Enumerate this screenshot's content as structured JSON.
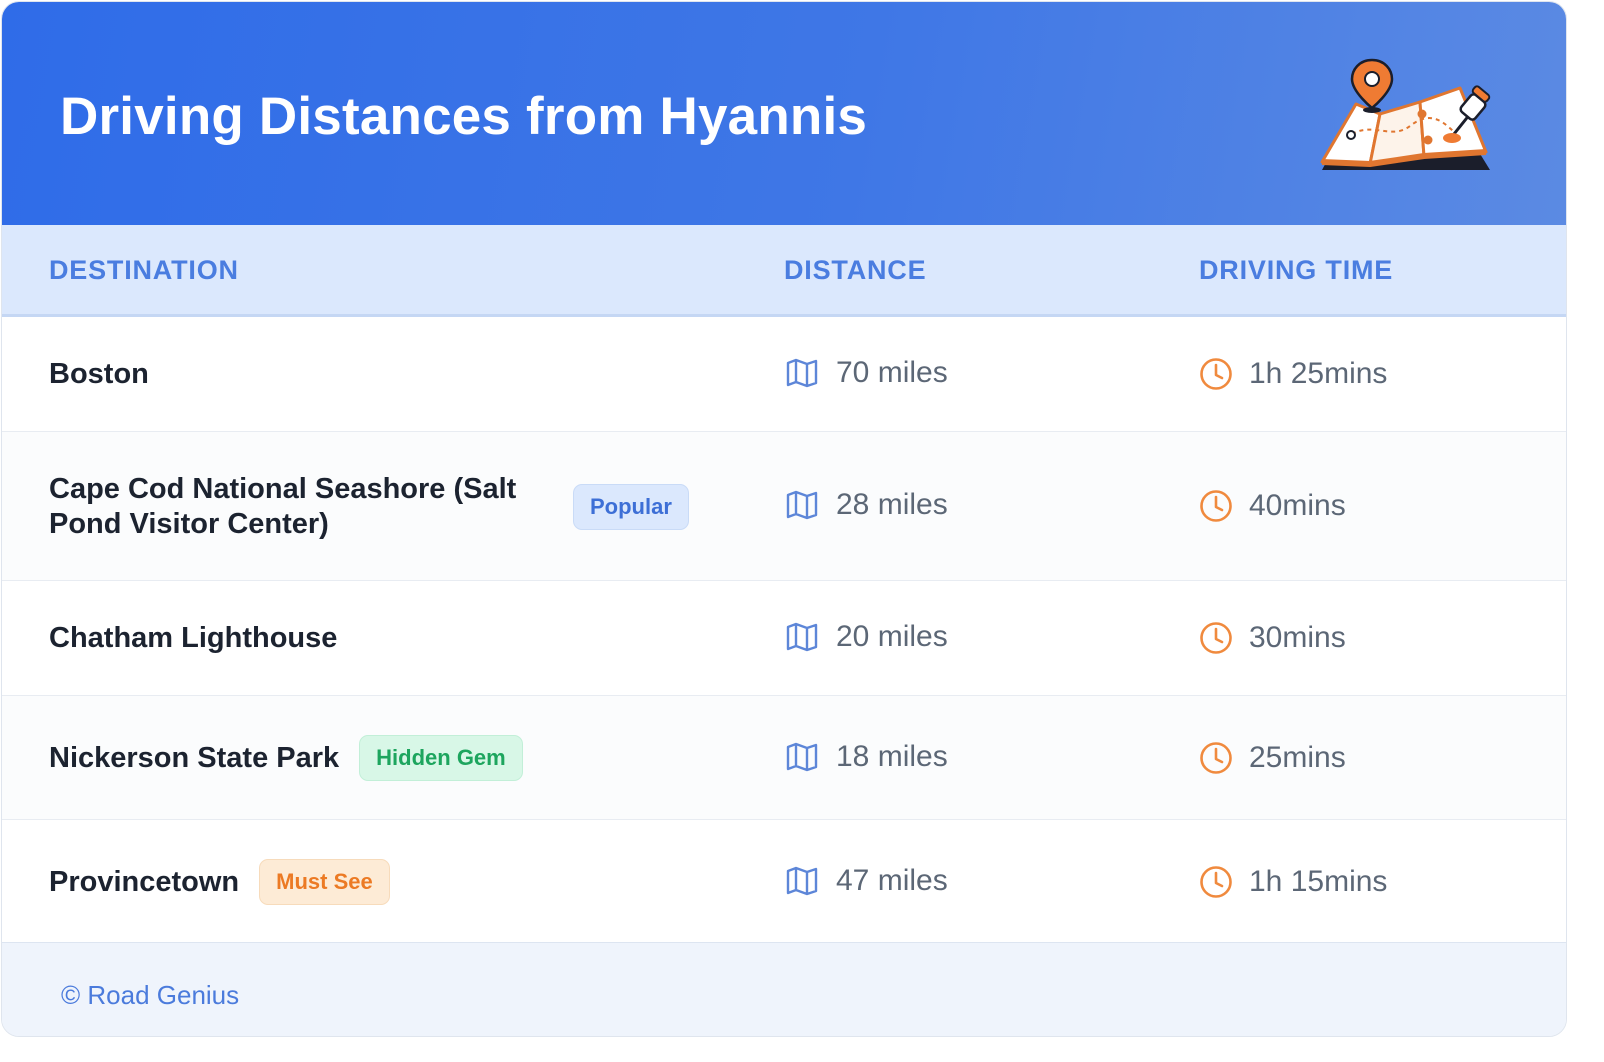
{
  "header": {
    "title": "Driving Distances from Hyannis"
  },
  "table": {
    "columns": {
      "destination": "DESTINATION",
      "distance": "DISTANCE",
      "driving_time": "DRIVING TIME"
    },
    "rows": [
      {
        "destination": "Boston",
        "badge": "",
        "distance": "70 miles",
        "time": "1h 25mins"
      },
      {
        "destination": "Cape Cod National Seashore (Salt Pond Visitor Center)",
        "badge": "Popular",
        "distance": "28 miles",
        "time": "40mins"
      },
      {
        "destination": "Chatham Lighthouse",
        "badge": "",
        "distance": "20 miles",
        "time": "30mins"
      },
      {
        "destination": "Nickerson State Park",
        "badge": "Hidden Gem",
        "distance": "18 miles",
        "time": "25mins"
      },
      {
        "destination": "Provincetown",
        "badge": "Must See",
        "distance": "47 miles",
        "time": "1h 15mins"
      }
    ]
  },
  "footer": {
    "credit": "© Road Genius"
  },
  "icons": {
    "distance": "map-icon",
    "time": "clock-icon",
    "illustration": "folded-map-with-pins"
  },
  "colors": {
    "header_gradient_start": "#2f6ce8",
    "header_gradient_end": "#5b8ae3",
    "column_header_bg": "#dbe8fd",
    "column_header_text": "#4a7de0",
    "map_icon": "#5d86d8",
    "clock_icon": "#f08a3e",
    "badge_popular": "#3d6fd6",
    "badge_hidden_gem": "#1da55e",
    "badge_must_see": "#ec7a24"
  }
}
